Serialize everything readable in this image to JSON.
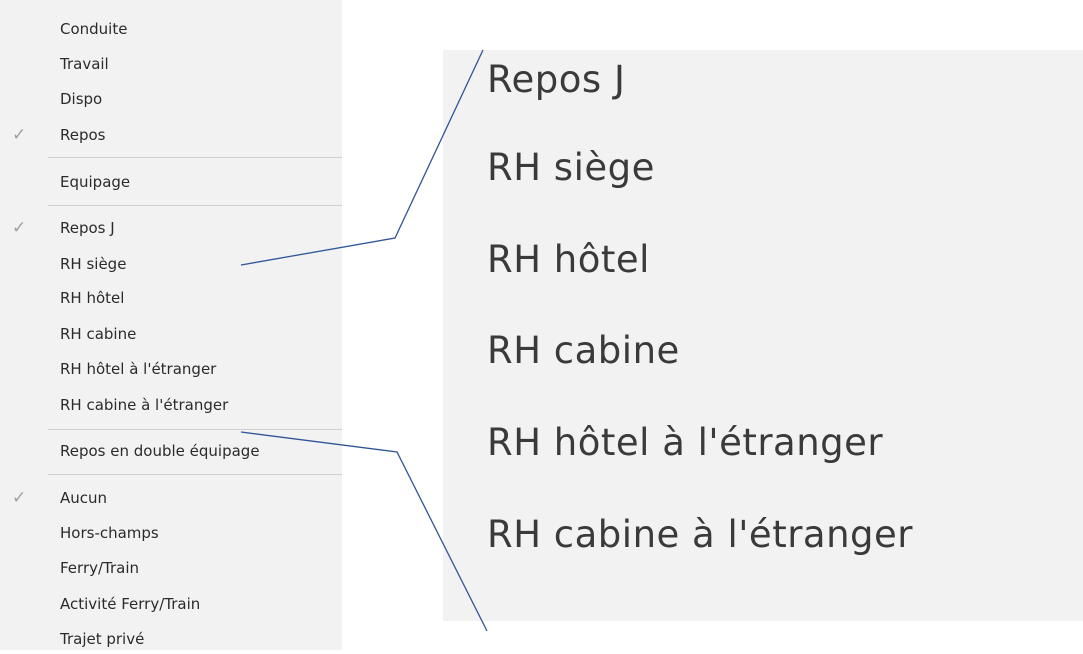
{
  "menu": {
    "items": [
      {
        "label": "Conduite",
        "checked": false
      },
      {
        "label": "Travail",
        "checked": false
      },
      {
        "label": "Dispo",
        "checked": false
      },
      {
        "label": "Repos",
        "checked": true
      },
      {
        "label": "Equipage",
        "checked": false
      },
      {
        "label": "Repos J",
        "checked": true
      },
      {
        "label": "RH siège",
        "checked": false
      },
      {
        "label": "RH hôtel",
        "checked": false
      },
      {
        "label": "RH cabine",
        "checked": false
      },
      {
        "label": "RH hôtel à l'étranger",
        "checked": false
      },
      {
        "label": "RH cabine à l'étranger",
        "checked": false
      },
      {
        "label": "Repos en double équipage",
        "checked": false
      },
      {
        "label": "Aucun",
        "checked": true
      },
      {
        "label": "Hors-champs",
        "checked": false
      },
      {
        "label": "Ferry/Train",
        "checked": false
      },
      {
        "label": "Activité Ferry/Train",
        "checked": false
      },
      {
        "label": "Trajet privé",
        "checked": false
      }
    ],
    "check_glyph": "✓"
  },
  "zoom": {
    "items": [
      "Repos J",
      "RH siège",
      "RH hôtel",
      "RH cabine",
      "RH hôtel à l'étranger",
      "RH cabine à l'étranger"
    ]
  },
  "colors": {
    "menu_background": "#f2f2f2",
    "callout_line": "#2f5597",
    "check_color": "#a0a0a0"
  }
}
